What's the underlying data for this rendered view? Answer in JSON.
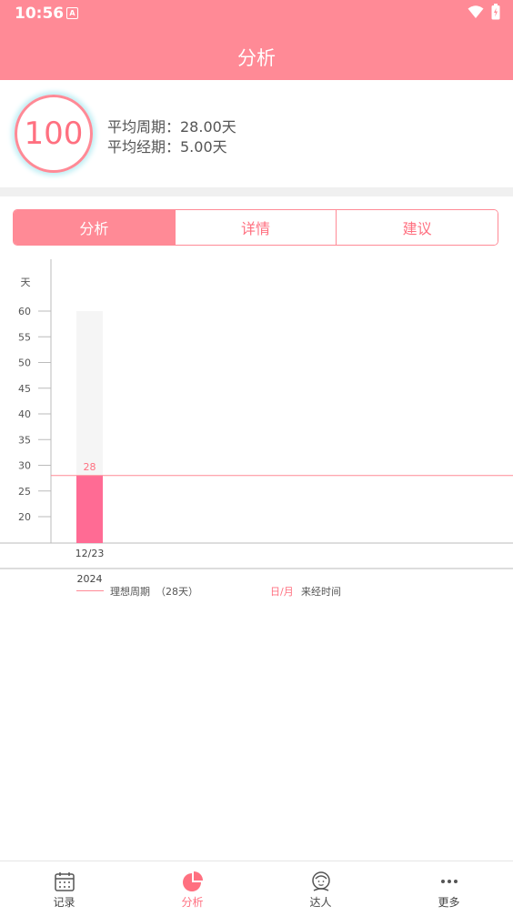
{
  "status": {
    "time": "10:56",
    "notif_icon": "A"
  },
  "header": {
    "title": "分析"
  },
  "score": {
    "value": "100",
    "avg_cycle": "平均周期：28.00天",
    "avg_period": "平均经期：5.00天"
  },
  "tabs": [
    {
      "label": "分析",
      "active": true
    },
    {
      "label": "详情",
      "active": false
    },
    {
      "label": "建议",
      "active": false
    }
  ],
  "chart_data": {
    "type": "bar",
    "ylabel": "天",
    "yticks": [
      20,
      25,
      30,
      35,
      40,
      45,
      50,
      55,
      60
    ],
    "ylim": [
      15,
      60
    ],
    "categories": [
      "12/23"
    ],
    "values": [
      28
    ],
    "background_values": [
      60
    ],
    "reference_line": 28,
    "year_label": "2024",
    "data_labels": [
      "28"
    ],
    "colors": {
      "bar": "#ff6b94",
      "bar_bg": "#f5f5f5",
      "line": "#ff8a96",
      "axis": "#bbbbbb"
    }
  },
  "legend": {
    "ideal_cycle": "理想周期",
    "ideal_value": "（28天）",
    "date_format": "日/月",
    "date_desc": "来经时间"
  },
  "bottom_nav": [
    {
      "label": "记录",
      "icon": "calendar-icon",
      "active": false
    },
    {
      "label": "分析",
      "icon": "pie-chart-icon",
      "active": true
    },
    {
      "label": "达人",
      "icon": "person-icon",
      "active": false
    },
    {
      "label": "更多",
      "icon": "more-icon",
      "active": false
    }
  ]
}
